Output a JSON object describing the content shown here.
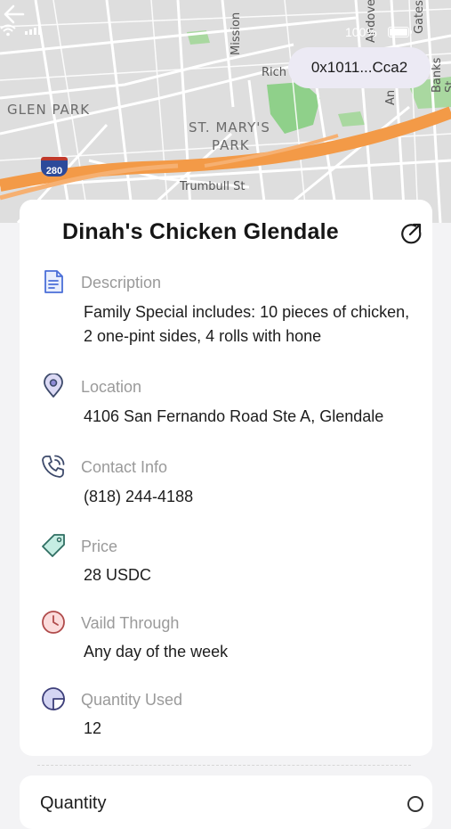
{
  "status_bar": {
    "battery": "100%"
  },
  "map": {
    "labels": {
      "glen_park": "GLEN PARK",
      "st_marys_line1": "ST. MARY'S",
      "st_marys_line2": "PARK",
      "trumbull": "Trumbull St",
      "mission": "Mission",
      "richland": "Rich",
      "banks": "Banks St",
      "gates": "Gates",
      "andover": "Andover St",
      "an": "An",
      "highway": "280"
    }
  },
  "header": {
    "wallet_address": "0x1011...Cca2"
  },
  "offer": {
    "title": "Dinah's Chicken Glendale",
    "fields": [
      {
        "icon": "document-icon",
        "label": "Description",
        "value": "Family Special includes: 10 pieces of chicken, 2 one-pint sides, 4 rolls with hone"
      },
      {
        "icon": "location-pin-icon",
        "label": "Location",
        "value": "4106 San Fernando Road Ste A, Glendale"
      },
      {
        "icon": "phone-icon",
        "label": "Contact Info",
        "value": "(818) 244-4188"
      },
      {
        "icon": "price-tag-icon",
        "label": "Price",
        "value": "28 USDC"
      },
      {
        "icon": "clock-icon",
        "label": "Vaild Through",
        "value": "Any day of the week"
      },
      {
        "icon": "pie-chart-icon",
        "label": "Quantity Used",
        "value": "12"
      }
    ]
  },
  "quantity_section": {
    "label": "Quantity"
  },
  "colors": {
    "document": "#4a6fd8",
    "location": "#8e8ad6",
    "phone": "#3d4a6b",
    "price": "#57c3ad",
    "clock": "#e27878",
    "pie": "#6f72c8",
    "highway": "#f39a47"
  }
}
